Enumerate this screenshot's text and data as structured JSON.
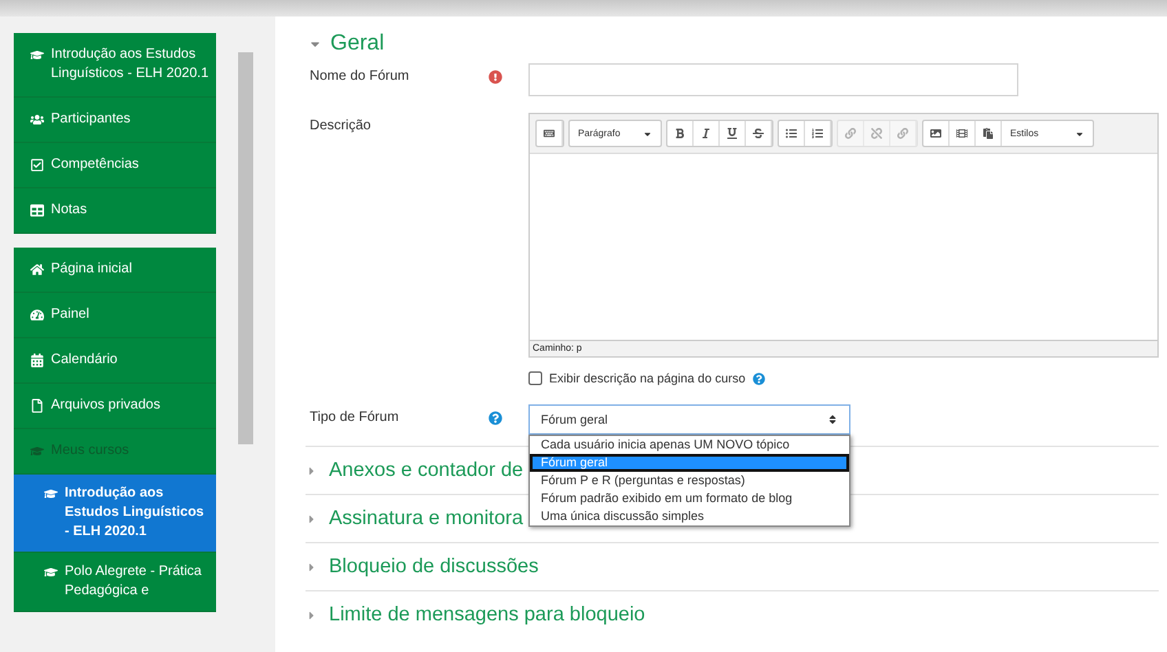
{
  "sidebar": {
    "groups": [
      {
        "items": [
          {
            "kind": "link",
            "label": "Introdução aos Estudos Linguísticos - ELH 2020.1",
            "selected": false
          },
          {
            "kind": "link",
            "label": "Participantes",
            "selected": false
          },
          {
            "kind": "link",
            "label": "Competências",
            "selected": false
          },
          {
            "kind": "link",
            "label": "Notas",
            "selected": false
          }
        ]
      },
      {
        "items": [
          {
            "kind": "link",
            "label": "Página inicial",
            "selected": false
          },
          {
            "kind": "link",
            "label": "Painel",
            "selected": false
          },
          {
            "kind": "link",
            "label": "Calendário",
            "selected": false
          },
          {
            "kind": "link",
            "label": "Arquivos privados",
            "selected": false
          },
          {
            "kind": "heading",
            "label": "Meus cursos",
            "selected": false
          },
          {
            "kind": "course",
            "label": "Introdução aos Estudos Linguísticos - ELH 2020.1",
            "selected": true
          },
          {
            "kind": "course",
            "label": "Polo Alegrete - Prática Pedagógica e",
            "selected": false
          }
        ]
      }
    ]
  },
  "form": {
    "section": "Geral",
    "expanded": true,
    "name_label": "Nome do Fórum",
    "description_label": "Descrição",
    "editor": {
      "paragraph": "Parágrafo",
      "styles": "Estilos",
      "path": "Caminho: p"
    },
    "show_description": {
      "label": "Exibir descrição na página do curso",
      "checked": false
    },
    "type_label": "Tipo de Fórum",
    "type_select": {
      "value": "Fórum geral",
      "options": [
        {
          "label": "Cada usuário inicia apenas UM NOVO tópico",
          "selected": false
        },
        {
          "label": "Fórum geral",
          "selected": true
        },
        {
          "label": "Fórum P e R (perguntas e respostas)",
          "selected": false
        },
        {
          "label": "Fórum padrão exibido em um formato de blog",
          "selected": false
        },
        {
          "label": "Uma única discussão simples",
          "selected": false
        }
      ]
    }
  },
  "sections": [
    {
      "label": "Anexos e contador de",
      "expanded": false
    },
    {
      "label": "Assinatura e monitora",
      "expanded": false
    },
    {
      "label": "Bloqueio de discussões",
      "expanded": false
    },
    {
      "label": "Limite de mensagens para bloqueio",
      "expanded": false
    }
  ]
}
